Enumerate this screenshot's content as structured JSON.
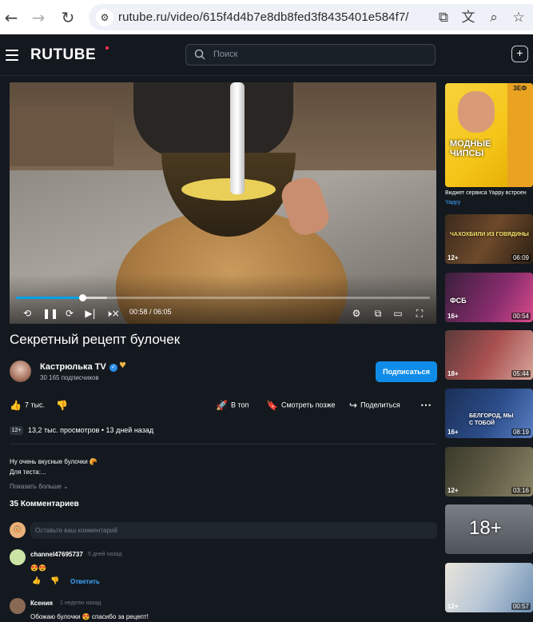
{
  "browser": {
    "url": "rutube.ru/video/615f4d4b7e8db8fed3f8435401e584f7/",
    "icons": [
      "back-icon",
      "forward-icon",
      "reload-icon",
      "site-info-icon",
      "open-in-app-icon",
      "translate-icon",
      "zoom-icon",
      "bookmark-star-icon"
    ]
  },
  "header": {
    "logo": "RUTUBE",
    "search_placeholder": "Поиск",
    "icons": [
      "menu-icon",
      "search-icon",
      "upload-icon"
    ]
  },
  "player": {
    "progress_fraction": 0.16,
    "time_current": "00:58",
    "time_total": "06:05",
    "time_display": "00:58 / 06:05",
    "icons": [
      "rewind-10-icon",
      "pause-icon",
      "forward-10-icon",
      "next-icon",
      "mute-icon",
      "settings-icon",
      "miniplayer-icon",
      "theater-icon",
      "fullscreen-icon"
    ]
  },
  "video": {
    "title": "Секретный рецепт булочек",
    "channel_name": "Кастрюлька TV",
    "subscribers": "30 165 подписчиков",
    "subscribe_label": "Подписаться",
    "likes": "7 тыс.",
    "to_top_label": "В топ",
    "watch_later_label": "Смотреть позже",
    "share_label": "Поделиться",
    "age_rating": "12+",
    "views_and_date": "13,2 тыс. просмотров • 13 дней назад"
  },
  "description": {
    "line1": "Ну очень вкусные булочки 🥐",
    "line2": "Для теста:...",
    "show_more": "Показать больше ⌄"
  },
  "comments": {
    "title": "35 Комментариев",
    "input_placeholder": "Оставьте ваш комментарий",
    "items": [
      {
        "author": "channel47695737",
        "time": "5 дней назад",
        "text": "😍😍",
        "reply_label": "Ответить"
      },
      {
        "author": "Ксения",
        "time": "1 неделю назад",
        "text": "Обожаю булочки 😍 спасибо за рецепт!"
      }
    ]
  },
  "sidebar": {
    "ad": {
      "thumb_text": "МОДНЫЕ ЧИПСЫ",
      "side_text": "ЗЕФ",
      "caption": "Виджет сервиса Yappy встроен",
      "sponsor": "Yappy"
    },
    "items": [
      {
        "age": "12+",
        "duration": "06:09",
        "overlay": "ЧАХОХБИЛИ ИЗ ГОВЯДИНЫ"
      },
      {
        "age": "16+",
        "duration": "00:54",
        "overlay": "ФСБ"
      },
      {
        "age": "18+",
        "duration": "05:44",
        "overlay": ""
      },
      {
        "age": "16+",
        "duration": "08:19",
        "overlay": "БЕЛГОРОД, МЫ С ТОБОЙ"
      },
      {
        "age": "12+",
        "duration": "03:16",
        "overlay": ""
      },
      {
        "age": "",
        "duration": "",
        "overlay": "18+"
      },
      {
        "age": "12+",
        "duration": "00:57",
        "overlay": ""
      }
    ]
  },
  "colors": {
    "accent": "#00a1e7",
    "subscribe": "#0f8ce8",
    "background": "#14191f",
    "logo_dot": "#ff2e4d"
  }
}
